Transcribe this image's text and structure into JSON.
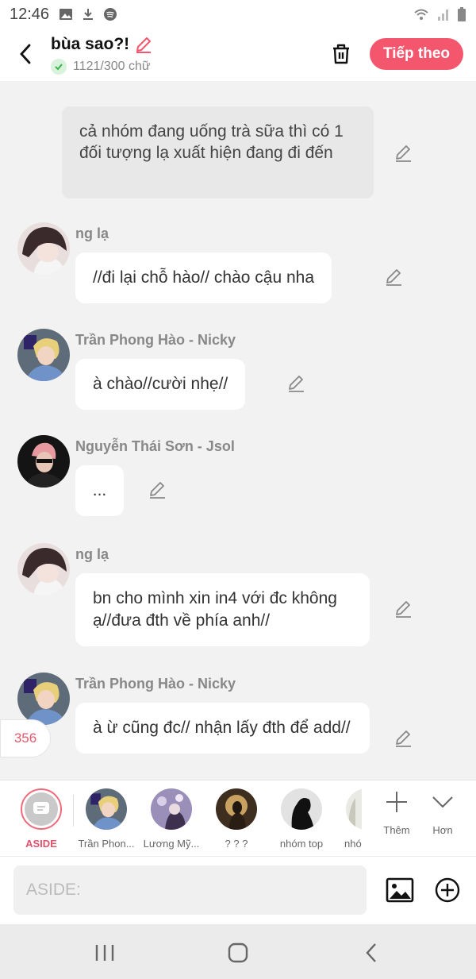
{
  "status": {
    "time": "12:46"
  },
  "header": {
    "title": "bùa sao?!",
    "word_count": "1121/300 chữ",
    "next_label": "Tiếp theo",
    "accent": "#f4566d"
  },
  "chat": {
    "narration": "cả nhóm đang uống trà sữa thì có 1 đối tượng lạ xuất hiện đang đi đến",
    "messages": [
      {
        "sender": "ng lạ",
        "text": "//đi lại chỗ hào// chào cậu nha"
      },
      {
        "sender": "Trần Phong Hào - Nicky",
        "text": "à chào//cười nhẹ//"
      },
      {
        "sender": "Nguyễn Thái Sơn - Jsol",
        "text": "..."
      },
      {
        "sender": "ng lạ",
        "text": "bn cho mình xin in4 với đc không ạ//đưa đth về phía anh//"
      },
      {
        "sender": "Trần Phong Hào - Nicky",
        "text": "à ừ cũng đc// nhận lấy đth để add//"
      }
    ],
    "count_badge": "356"
  },
  "characters": {
    "aside_label": "ASIDE",
    "items": [
      {
        "name": "Trần Phon..."
      },
      {
        "name": "Lương Mỹ..."
      },
      {
        "name": "? ? ?"
      },
      {
        "name": "nhóm top"
      },
      {
        "name": "nhó"
      }
    ],
    "more_label": "Thêm",
    "expand_label": "Hơn"
  },
  "input": {
    "placeholder": "ASIDE:"
  }
}
